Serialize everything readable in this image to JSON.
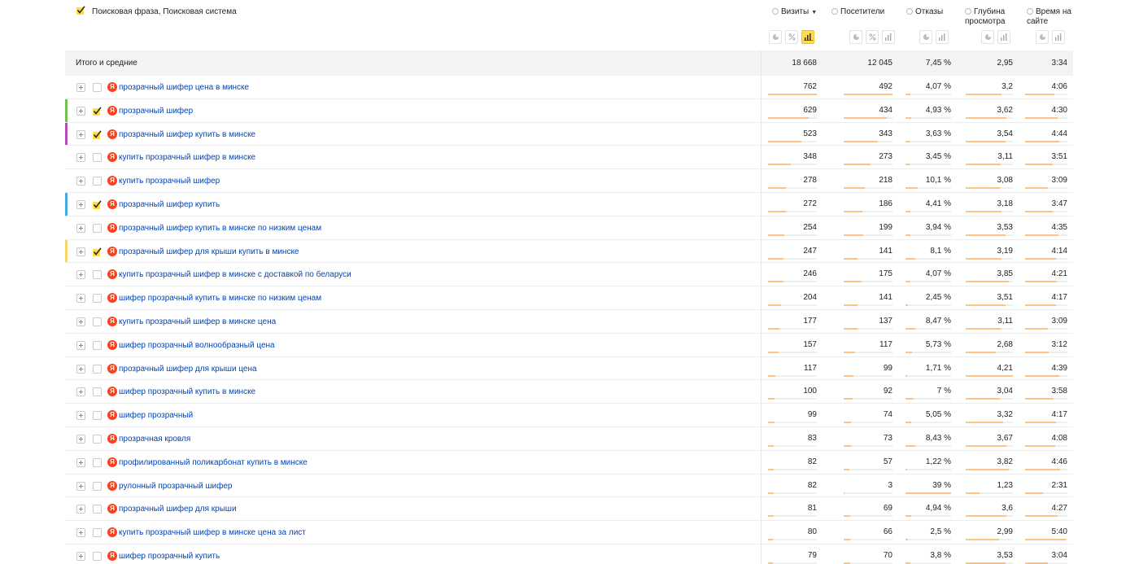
{
  "header": {
    "dimension_label": "Поисковая фраза, Поисковая система",
    "metrics": [
      {
        "label": "Визиты",
        "sorted": true,
        "sort_icon": "▼",
        "active_view": "bar-chart-icon"
      },
      {
        "label": "Посетители",
        "active_view": ""
      },
      {
        "label": "Отказы",
        "active_view": ""
      },
      {
        "label": "Глубина просмотра",
        "active_view": ""
      },
      {
        "label": "Время на сайте",
        "active_view": ""
      }
    ]
  },
  "totals": {
    "label": "Итого и средние",
    "visits": "18 668",
    "visitors": "12 045",
    "bounce": "7,45 %",
    "depth": "2,95",
    "time": "3:34"
  },
  "search_engine_icon": "Я",
  "colors": {
    "link": "#0044bb",
    "bar": "#fcc586",
    "check": "#ffdb4d",
    "yandex": "#fc3f1d",
    "accent_green": "#72c054",
    "accent_purple": "#b54ab9",
    "accent_blue": "#46a8e0",
    "accent_yellow": "#f7d767"
  },
  "rows": [
    {
      "phrase": "прозрачный шифер цена в минске",
      "checked": false,
      "accent": "",
      "visits": "762",
      "visitors": "492",
      "bounce": "4,07 %",
      "depth": "3,2",
      "time": "4:06",
      "bar": {
        "visits": 1.0,
        "visitors": 1.0,
        "bounce": 0.1,
        "depth": 0.76,
        "time": 0.7
      }
    },
    {
      "phrase": "прозрачный шифер",
      "checked": true,
      "accent": "#72c054",
      "visits": "629",
      "visitors": "434",
      "bounce": "4,93 %",
      "depth": "3,62",
      "time": "4:30",
      "bar": {
        "visits": 0.83,
        "visitors": 0.88,
        "bounce": 0.13,
        "depth": 0.86,
        "time": 0.77
      }
    },
    {
      "phrase": "прозрачный шифер купить в минске",
      "checked": true,
      "accent": "#b54ab9",
      "visits": "523",
      "visitors": "343",
      "bounce": "3,63 %",
      "depth": "3,54",
      "time": "4:44",
      "bar": {
        "visits": 0.69,
        "visitors": 0.7,
        "bounce": 0.09,
        "depth": 0.84,
        "time": 0.81
      }
    },
    {
      "phrase": "купить прозрачный шифер в минске",
      "checked": false,
      "accent": "",
      "visits": "348",
      "visitors": "273",
      "bounce": "3,45 %",
      "depth": "3,11",
      "time": "3:51",
      "bar": {
        "visits": 0.46,
        "visitors": 0.55,
        "bounce": 0.09,
        "depth": 0.74,
        "time": 0.66
      }
    },
    {
      "phrase": "купить прозрачный шифер",
      "checked": false,
      "accent": "",
      "visits": "278",
      "visitors": "218",
      "bounce": "10,1 %",
      "depth": "3,08",
      "time": "3:09",
      "bar": {
        "visits": 0.36,
        "visitors": 0.44,
        "bounce": 0.26,
        "depth": 0.73,
        "time": 0.54
      }
    },
    {
      "phrase": "прозрачный шифер купить",
      "checked": true,
      "accent": "#46a8e0",
      "visits": "272",
      "visitors": "186",
      "bounce": "4,41 %",
      "depth": "3,18",
      "time": "3:47",
      "bar": {
        "visits": 0.36,
        "visitors": 0.38,
        "bounce": 0.11,
        "depth": 0.76,
        "time": 0.65
      }
    },
    {
      "phrase": "прозрачный шифер купить в минске по низким ценам",
      "checked": false,
      "accent": "",
      "visits": "254",
      "visitors": "199",
      "bounce": "3,94 %",
      "depth": "3,53",
      "time": "4:35",
      "bar": {
        "visits": 0.33,
        "visitors": 0.4,
        "bounce": 0.1,
        "depth": 0.84,
        "time": 0.79
      }
    },
    {
      "phrase": "прозрачный шифер для крыши купить в минске",
      "checked": true,
      "accent": "#f7d767",
      "visits": "247",
      "visitors": "141",
      "bounce": "8,1 %",
      "depth": "3,19",
      "time": "4:14",
      "bar": {
        "visits": 0.32,
        "visitors": 0.29,
        "bounce": 0.21,
        "depth": 0.76,
        "time": 0.73
      }
    },
    {
      "phrase": "купить прозрачный шифер в минске с доставкой по беларуси",
      "checked": false,
      "accent": "",
      "visits": "246",
      "visitors": "175",
      "bounce": "4,07 %",
      "depth": "3,85",
      "time": "4:21",
      "bar": {
        "visits": 0.32,
        "visitors": 0.36,
        "bounce": 0.1,
        "depth": 0.92,
        "time": 0.75
      }
    },
    {
      "phrase": "шифер прозрачный купить в минске по низким ценам",
      "checked": false,
      "accent": "",
      "visits": "204",
      "visitors": "141",
      "bounce": "2,45 %",
      "depth": "3,51",
      "time": "4:17",
      "bar": {
        "visits": 0.27,
        "visitors": 0.29,
        "bounce": 0.06,
        "depth": 0.84,
        "time": 0.74
      }
    },
    {
      "phrase": "купить прозрачный шифер в минске цена",
      "checked": false,
      "accent": "",
      "visits": "177",
      "visitors": "137",
      "bounce": "8,47 %",
      "depth": "3,11",
      "time": "3:09",
      "bar": {
        "visits": 0.23,
        "visitors": 0.28,
        "bounce": 0.22,
        "depth": 0.74,
        "time": 0.54
      }
    },
    {
      "phrase": "шифер прозрачный волнообразный цена",
      "checked": false,
      "accent": "",
      "visits": "157",
      "visitors": "117",
      "bounce": "5,73 %",
      "depth": "2,68",
      "time": "3:12",
      "bar": {
        "visits": 0.21,
        "visitors": 0.24,
        "bounce": 0.15,
        "depth": 0.64,
        "time": 0.55
      }
    },
    {
      "phrase": "прозрачный шифер для крыши цена",
      "checked": false,
      "accent": "",
      "visits": "117",
      "visitors": "99",
      "bounce": "1,71 %",
      "depth": "4,21",
      "time": "4:39",
      "bar": {
        "visits": 0.15,
        "visitors": 0.2,
        "bounce": 0.04,
        "depth": 1.0,
        "time": 0.8
      }
    },
    {
      "phrase": "шифер прозрачный купить в минске",
      "checked": false,
      "accent": "",
      "visits": "100",
      "visitors": "92",
      "bounce": "7 %",
      "depth": "3,04",
      "time": "3:58",
      "bar": {
        "visits": 0.13,
        "visitors": 0.19,
        "bounce": 0.18,
        "depth": 0.72,
        "time": 0.68
      }
    },
    {
      "phrase": "шифер прозрачный",
      "checked": false,
      "accent": "",
      "visits": "99",
      "visitors": "74",
      "bounce": "5,05 %",
      "depth": "3,32",
      "time": "4:17",
      "bar": {
        "visits": 0.13,
        "visitors": 0.15,
        "bounce": 0.13,
        "depth": 0.79,
        "time": 0.74
      }
    },
    {
      "phrase": "прозрачная кровля",
      "checked": false,
      "accent": "",
      "visits": "83",
      "visitors": "73",
      "bounce": "8,43 %",
      "depth": "3,67",
      "time": "4:08",
      "bar": {
        "visits": 0.11,
        "visitors": 0.15,
        "bounce": 0.22,
        "depth": 0.87,
        "time": 0.71
      }
    },
    {
      "phrase": "профилированный поликарбонат купить в минске",
      "checked": false,
      "accent": "",
      "visits": "82",
      "visitors": "57",
      "bounce": "1,22 %",
      "depth": "3,82",
      "time": "4:46",
      "bar": {
        "visits": 0.11,
        "visitors": 0.12,
        "bounce": 0.03,
        "depth": 0.91,
        "time": 0.82
      }
    },
    {
      "phrase": "рулонный прозрачный шифер",
      "checked": false,
      "accent": "",
      "visits": "82",
      "visitors": "3",
      "bounce": "39 %",
      "depth": "1,23",
      "time": "2:31",
      "bar": {
        "visits": 0.11,
        "visitors": 0.01,
        "bounce": 1.0,
        "depth": 0.29,
        "time": 0.43
      }
    },
    {
      "phrase": "прозрачный шифер для крыши",
      "checked": false,
      "accent": "",
      "visits": "81",
      "visitors": "69",
      "bounce": "4,94 %",
      "depth": "3,6",
      "time": "4:27",
      "bar": {
        "visits": 0.11,
        "visitors": 0.14,
        "bounce": 0.13,
        "depth": 0.86,
        "time": 0.76
      }
    },
    {
      "phrase": "купить прозрачный шифер в минске цена за лист",
      "checked": false,
      "accent": "",
      "visits": "80",
      "visitors": "66",
      "bounce": "2,5 %",
      "depth": "2,99",
      "time": "5:40",
      "bar": {
        "visits": 0.1,
        "visitors": 0.13,
        "bounce": 0.06,
        "depth": 0.71,
        "time": 0.97
      }
    },
    {
      "phrase": "шифер прозрачный купить",
      "checked": false,
      "accent": "",
      "visits": "79",
      "visitors": "70",
      "bounce": "3,8 %",
      "depth": "3,53",
      "time": "3:04",
      "bar": {
        "visits": 0.1,
        "visitors": 0.14,
        "bounce": 0.1,
        "depth": 0.84,
        "time": 0.53
      }
    }
  ]
}
